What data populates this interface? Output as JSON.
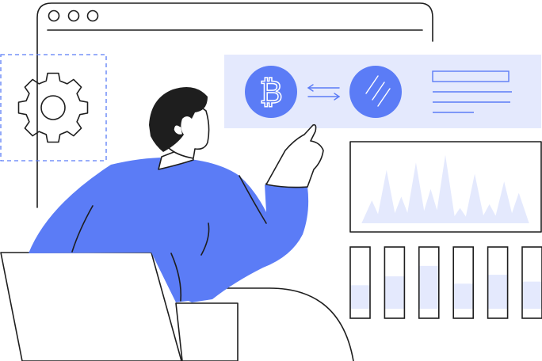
{
  "colors": {
    "accent": "#5b7cf6",
    "accent_light": "#e4e9fd",
    "outline": "#1e1e1e",
    "hair": "#1e2126",
    "background": "#ffffff"
  },
  "icons": {
    "exchange_from": "bitcoin-icon",
    "exchange_to": "currency-slash-icon",
    "exchange_arrows": "swap-arrows-icon",
    "settings": "gear-icon"
  },
  "symbols": {
    "from_currency": "₿"
  },
  "chart_data": {
    "type": "area",
    "series": [
      {
        "values": [
          0.3,
          0.7,
          0.35,
          0.8,
          0.45,
          0.9,
          0.2,
          0.65,
          0.25,
          0.55,
          0.4
        ]
      }
    ]
  },
  "level_bars": [
    {
      "level": 0.45
    },
    {
      "level": 0.62
    },
    {
      "level": 0.82
    },
    {
      "level": 0.48
    },
    {
      "level": 0.65
    },
    {
      "level": 0.52
    }
  ]
}
